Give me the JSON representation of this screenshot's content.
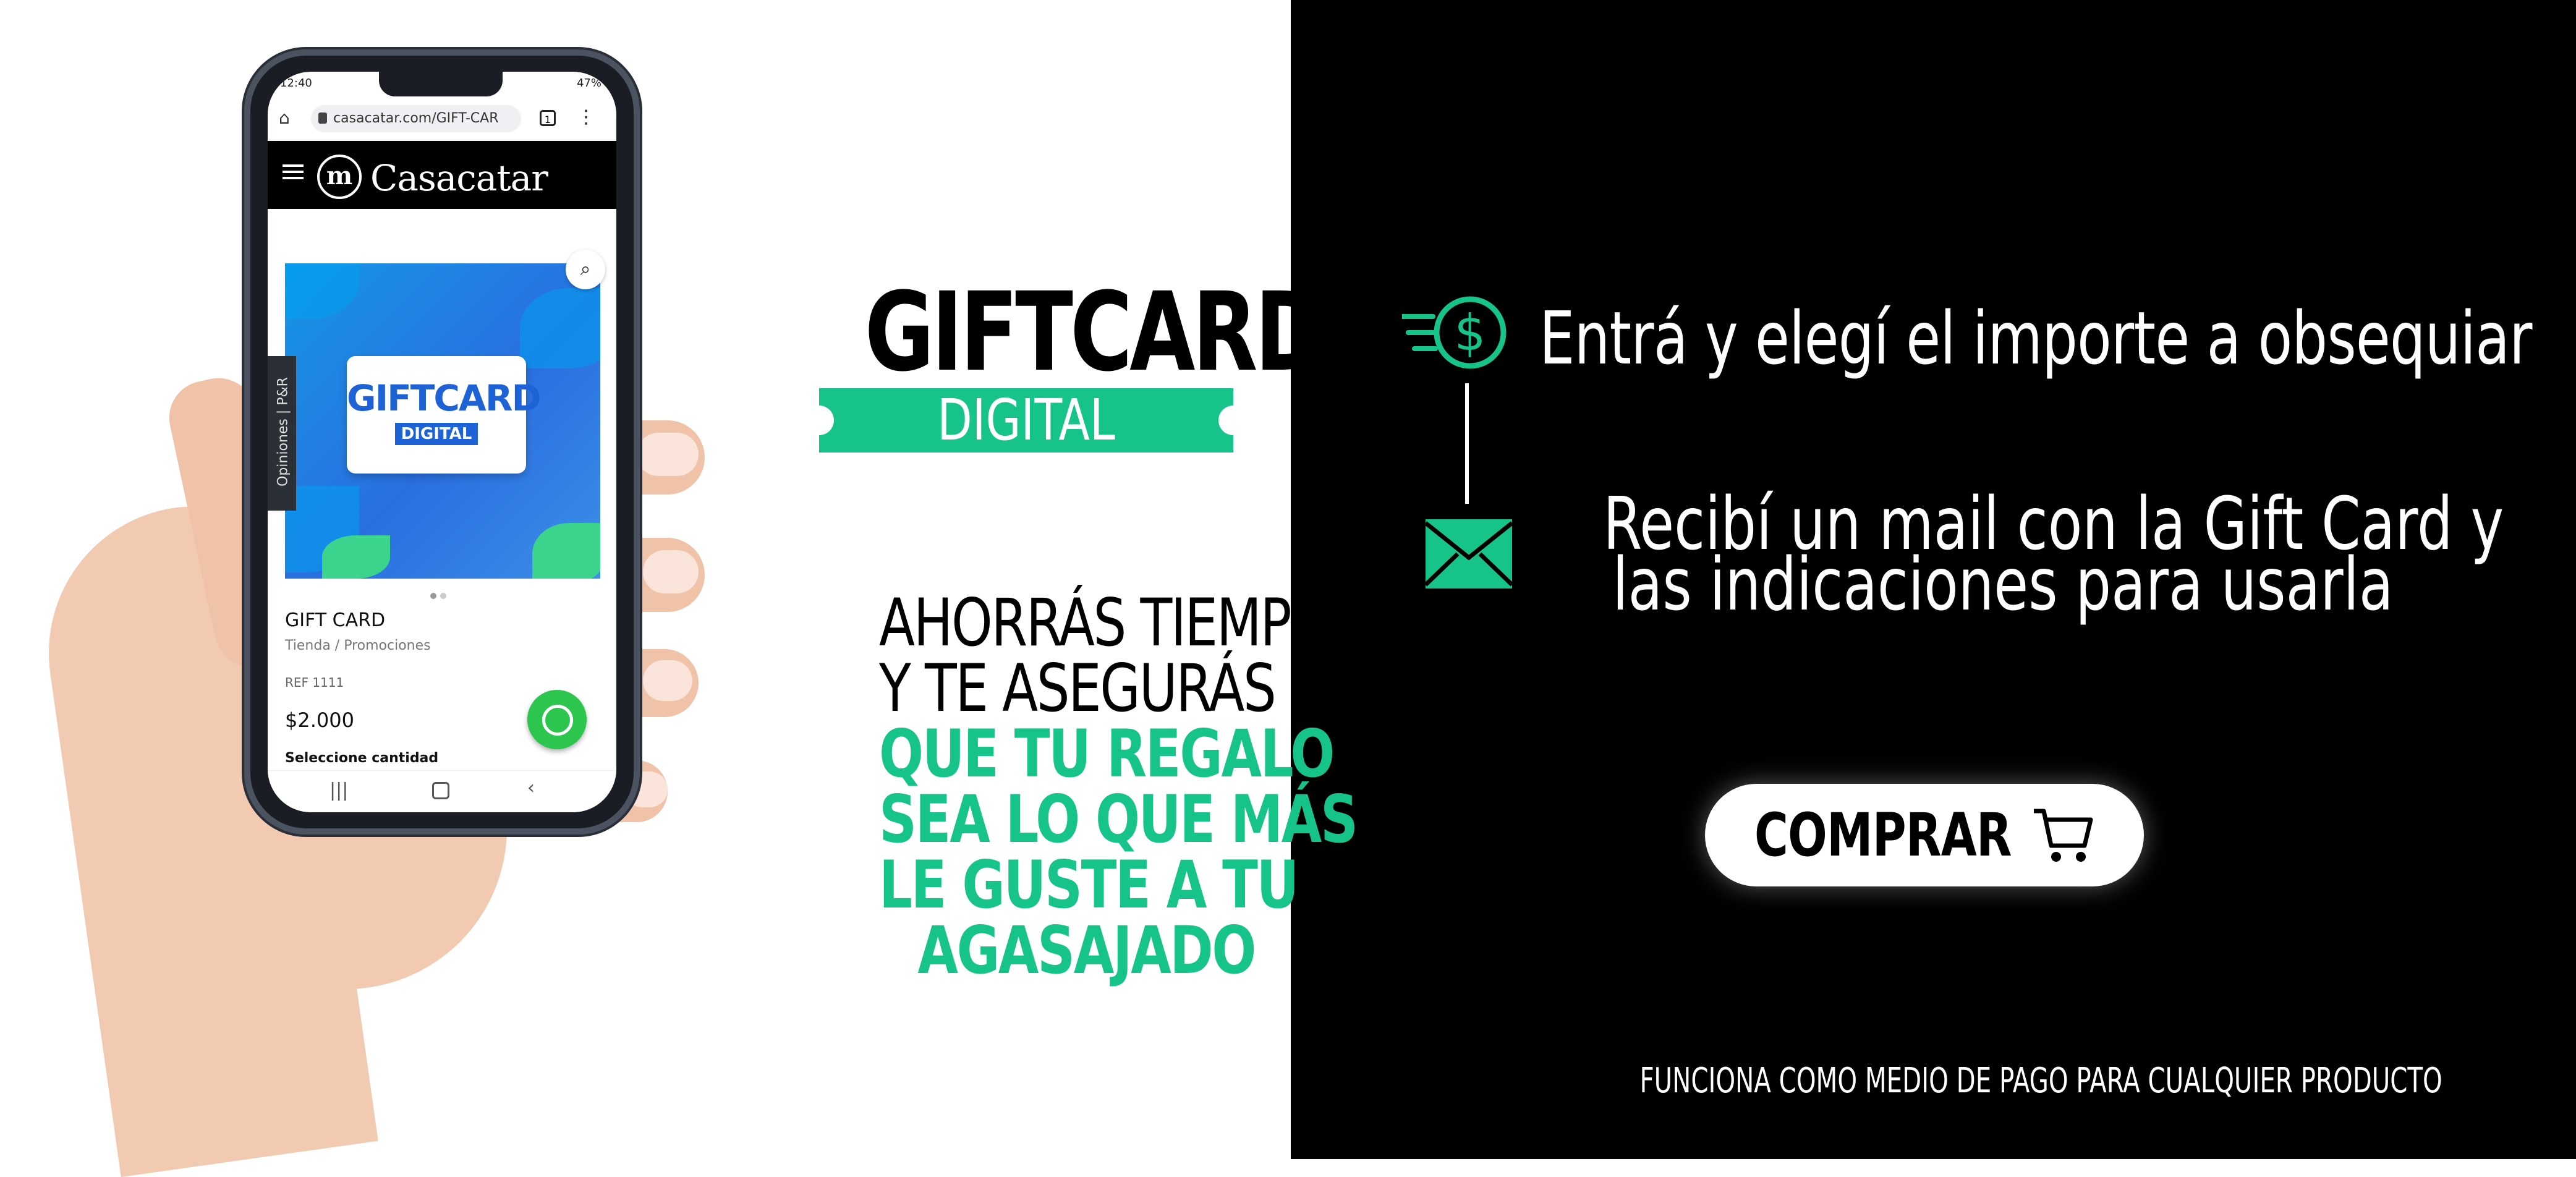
{
  "phone": {
    "status_time": "12:40",
    "status_battery": "47%",
    "url": "casacatar.com/GIFT-CAR",
    "tab_count": "1",
    "site_name": "Casacatar",
    "logo_letter": "m",
    "product_card_title": "GIFTCARD",
    "product_card_subtitle": "DIGITAL",
    "reviews_tab": "Opiniones | P&R",
    "product_title": "GIFT CARD",
    "breadcrumbs": "Tienda  /  Promociones",
    "ref": "REF 1111",
    "price": "$2.000",
    "quantity_label": "Seleccione cantidad",
    "icons": [
      "home-icon",
      "lock-icon",
      "menu-dots-icon",
      "hamburger-icon",
      "search-icon",
      "whatsapp-icon",
      "recent-apps-icon",
      "home-nav-icon",
      "back-icon"
    ]
  },
  "headline": {
    "title": "GIFTCARD",
    "ribbon": "DIGITAL"
  },
  "tagline": {
    "black_lines": [
      "AHORRÁS TIEMPO",
      "Y TE ASEGURÁS"
    ],
    "green_lines": [
      "QUE TU REGALO",
      "SEA LO QUE MÁS",
      "LE GUSTE A TU",
      "AGASAJADO"
    ]
  },
  "steps": {
    "step1": "Entrá y elegí el importe a obsequiar",
    "step2_lines": [
      "Recibí un mail con la Gift Card y",
      "las indicaciones para usarla"
    ],
    "icons": [
      "money-icon",
      "mail-icon"
    ]
  },
  "cta": {
    "label": "COMPRAR",
    "icon": "cart-icon"
  },
  "footer": {
    "note": "FUNCIONA COMO MEDIO DE PAGO PARA CUALQUIER PRODUCTO"
  },
  "colors": {
    "accent_green": "#16c48a",
    "background_left": "#ffffff",
    "background_right": "#000000",
    "whatsapp": "#2cc64f",
    "card_blue": "#1e63d6"
  }
}
